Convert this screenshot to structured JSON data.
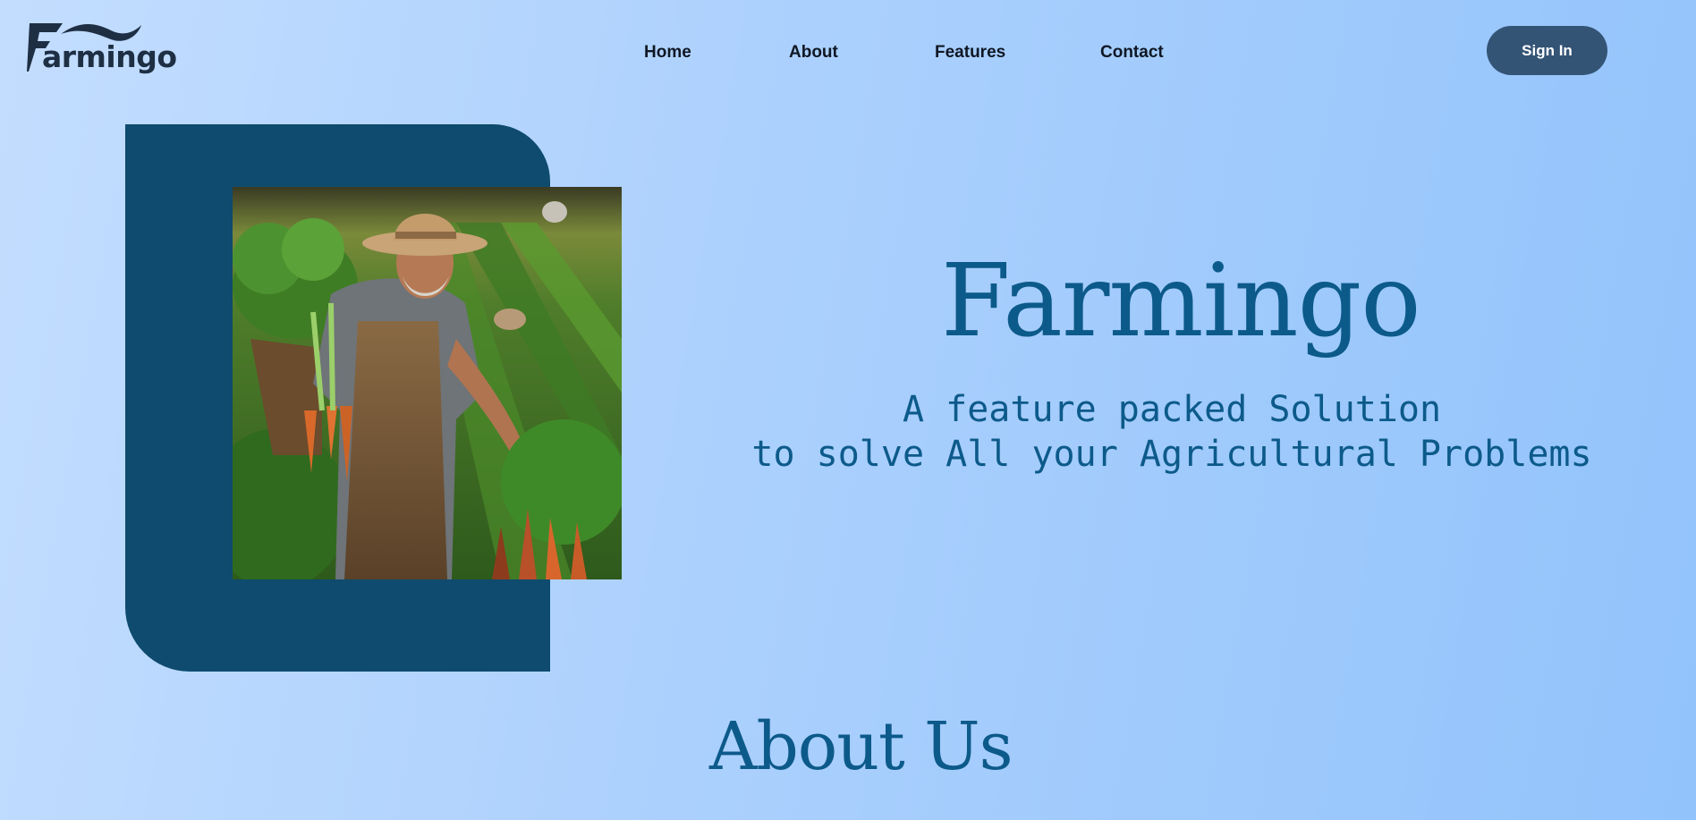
{
  "header": {
    "logo_text": "armingo",
    "logo_initial": "F",
    "nav": [
      {
        "label": "Home"
      },
      {
        "label": "About"
      },
      {
        "label": "Features"
      },
      {
        "label": "Contact"
      }
    ],
    "signin_label": "Sign In"
  },
  "hero": {
    "title": "Farmingo",
    "subtitle_line1": "A feature packed Solution",
    "subtitle_line2": "to solve All your Agricultural Problems",
    "image_icon": "farmer-carrots-photo"
  },
  "about": {
    "heading": "About Us"
  },
  "colors": {
    "primary": "#0e4b6e",
    "accent_text": "#0c5a8a",
    "button": "#345476",
    "background_start": "#c3ddfe",
    "background_end": "#92c3fb"
  }
}
